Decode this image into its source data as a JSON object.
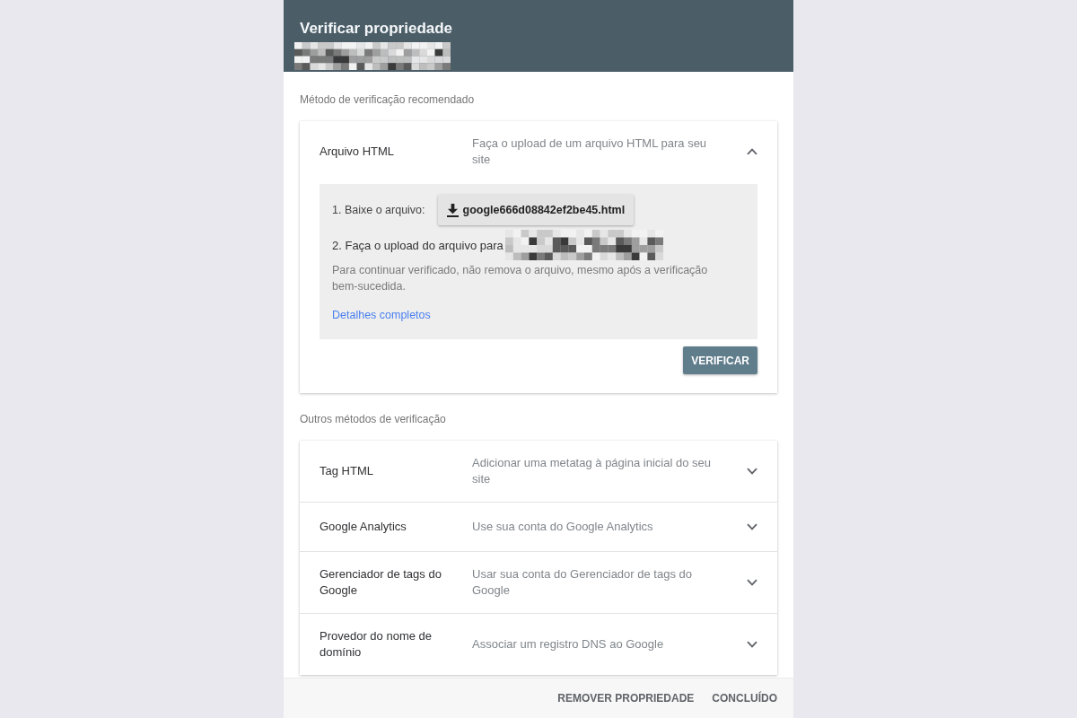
{
  "header": {
    "title": "Verificar propriedade"
  },
  "sections": [
    {
      "heading": "Método de verificação recomendado",
      "methods": [
        {
          "name": "Arquivo HTML",
          "description": "Faça o upload de um arquivo HTML para seu site",
          "expanded": true,
          "details": {
            "download_label": "1. Baixe o arquivo:",
            "file_name": "google666d08842ef2be45.html",
            "upload_label": "2. Faça o upload do arquivo para",
            "note": "Para continuar verificado, não remova o arquivo, mesmo após a verificação bem-sucedida.",
            "link": "Detalhes completos",
            "verify_button": "VERIFICAR"
          }
        }
      ]
    },
    {
      "heading": "Outros métodos de verificação",
      "methods": [
        {
          "name": "Tag HTML",
          "description": "Adicionar uma metatag à página inicial do seu site",
          "expanded": false
        },
        {
          "name": "Google Analytics",
          "description": "Use sua conta do Google Analytics",
          "expanded": false
        },
        {
          "name": "Gerenciador de tags do Google",
          "description": "Usar sua conta do Gerenciador de tags do Google",
          "expanded": false
        },
        {
          "name": "Provedor do nome de domínio",
          "description": "Associar um registro DNS ao Google",
          "expanded": false
        }
      ]
    }
  ],
  "footer": {
    "buttons": [
      "REMOVER PROPRIEDADE",
      "CONCLUÍDO"
    ]
  }
}
